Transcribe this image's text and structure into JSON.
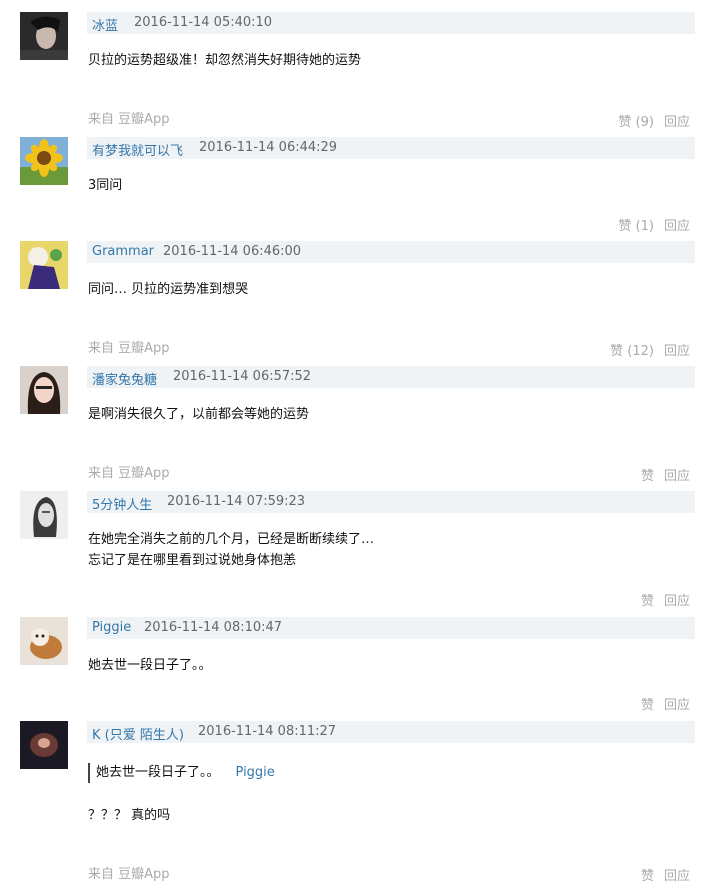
{
  "comments": [
    {
      "author": "冰蓝",
      "time": "2016-11-14 05:40:10",
      "lines": [
        "贝拉的运势超级准！却忽然消失好期待她的运势"
      ],
      "source": "来自 豆瓣App",
      "like": "赞 (9)",
      "reply": "回应",
      "avatar": "woman-dark-hair-avatar"
    },
    {
      "author": "有梦我就可以飞",
      "time": "2016-11-14 06:44:29",
      "lines": [
        "3同问"
      ],
      "source": "",
      "like": "赞 (1)",
      "reply": "回应",
      "avatar": "sunflower-avatar"
    },
    {
      "author": "Grammar",
      "time": "2016-11-14 06:46:00",
      "lines": [
        "同问… 贝拉的运势准到想哭"
      ],
      "source": "来自 豆瓣App",
      "like": "赞 (12)",
      "reply": "回应",
      "avatar": "cartoon-avatar"
    },
    {
      "author": "潘家兔兔糖",
      "time": "2016-11-14 06:57:52",
      "lines": [
        "是啊消失很久了，以前都会等她的运势"
      ],
      "source": "来自 豆瓣App",
      "like": "赞",
      "reply": "回应",
      "avatar": "girl-selfie-avatar"
    },
    {
      "author": "5分钟人生",
      "time": "2016-11-14 07:59:23",
      "lines": [
        "在她完全消失之前的几个月，已经是断断续续了…",
        "忘记了是在哪里看到过说她身体抱恙"
      ],
      "source": "",
      "like": "赞",
      "reply": "回应",
      "avatar": "bw-portrait-avatar"
    },
    {
      "author": "Piggie",
      "time": "2016-11-14 08:10:47",
      "lines": [
        "她去世一段日子了。。"
      ],
      "source": "",
      "like": "赞",
      "reply": "回应",
      "avatar": "dog-avatar"
    },
    {
      "author": "K (只爱 陌生人)",
      "time": "2016-11-14 08:11:27",
      "quote": {
        "text": "她去世一段日子了。。",
        "author": "Piggie"
      },
      "lines": [
        "？？？ 真的吗"
      ],
      "source": "来自 豆瓣App",
      "like": "赞",
      "reply": "回应",
      "avatar": "dark-avatar"
    }
  ],
  "colors": {
    "link": "#3377aa",
    "header_bg": "#f0f3f5",
    "muted": "#aaaaaa"
  }
}
